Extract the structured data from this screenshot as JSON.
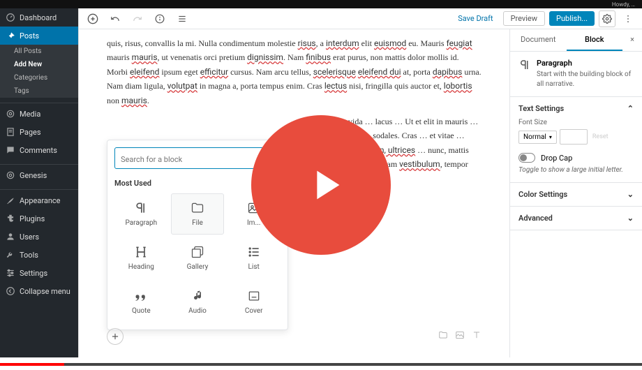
{
  "topbar": {
    "greeting": "Howdy, …"
  },
  "sidebar": {
    "items": [
      {
        "icon": "dashboard",
        "label": "Dashboard"
      },
      {
        "icon": "pin",
        "label": "Posts",
        "active": true
      },
      {
        "sub": true,
        "label": "All Posts"
      },
      {
        "sub": true,
        "label": "Add New",
        "current": true
      },
      {
        "sub": true,
        "label": "Categories"
      },
      {
        "sub": true,
        "label": "Tags"
      },
      {
        "icon": "media",
        "label": "Media"
      },
      {
        "icon": "page",
        "label": "Pages"
      },
      {
        "icon": "comment",
        "label": "Comments"
      },
      {
        "icon": "genesis",
        "label": "Genesis"
      },
      {
        "icon": "brush",
        "label": "Appearance"
      },
      {
        "icon": "plugin",
        "label": "Plugins"
      },
      {
        "icon": "user",
        "label": "Users"
      },
      {
        "icon": "wrench",
        "label": "Tools"
      },
      {
        "icon": "sliders",
        "label": "Settings"
      },
      {
        "icon": "collapse",
        "label": "Collapse menu"
      }
    ]
  },
  "toolbar": {
    "save_draft": "Save Draft",
    "preview": "Preview",
    "publish": "Publish..."
  },
  "body_html": "quis, risus, convallis la mi. Nulla condimentum molestie <u>risus</u>, a <u>interdum</u> elit <u>euismod</u> eu. Mauris <u>feugiat</u> mauris <u>mauris</u>, ut venenatis orci pretium <u>dignissim</u>. Nam <u>finibus</u> erat purus, non mattis dolor mollis id. Morbi <u>eleifend</u> ipsum eget <u>efficitur</u> cursus. Nam arcu tellus, <u>scelerisque</u> <u>eleifend dui</u> at, porta <u>dapibus</u> urna. Nam diam ligula, <u>volutpat</u> in magna a, porta tempus enim. Cras <u>lectus</u> nisi, fringilla quis auctor et, <u>lobortis</u> non <u>mauris</u>.",
  "body_html2": "… sit amet … gravida … lacus … Ut et elit in mauris … erat eget … Morbi sit … sodales. Cras … et vitae … lacus a … ei <u>dui accumsan, ultrices</u> … nunc, mattis <u>consectetur</u> … mauris ut quam <u>vestibulum</u>, tempor",
  "inserter": {
    "search_placeholder": "Search for a block",
    "section": "Most Used",
    "blocks": [
      {
        "icon": "paragraph",
        "label": "Paragraph"
      },
      {
        "icon": "file",
        "label": "File",
        "hover": true
      },
      {
        "icon": "image",
        "label": "Im..."
      },
      {
        "icon": "heading",
        "label": "Heading"
      },
      {
        "icon": "gallery",
        "label": "Gallery"
      },
      {
        "icon": "list",
        "label": "List"
      },
      {
        "icon": "quote",
        "label": "Quote"
      },
      {
        "icon": "audio",
        "label": "Audio"
      },
      {
        "icon": "cover",
        "label": "Cover"
      }
    ]
  },
  "panel": {
    "tabs": {
      "document": "Document",
      "block": "Block"
    },
    "block_name": "Paragraph",
    "block_desc": "Start with the building block of all narrative.",
    "text_settings": "Text Settings",
    "font_size_label": "Font Size",
    "font_size_value": "Normal",
    "reset": "Reset",
    "drop_cap": "Drop Cap",
    "drop_cap_desc": "Toggle to show a large initial letter.",
    "color_settings": "Color Settings",
    "advanced": "Advanced"
  }
}
